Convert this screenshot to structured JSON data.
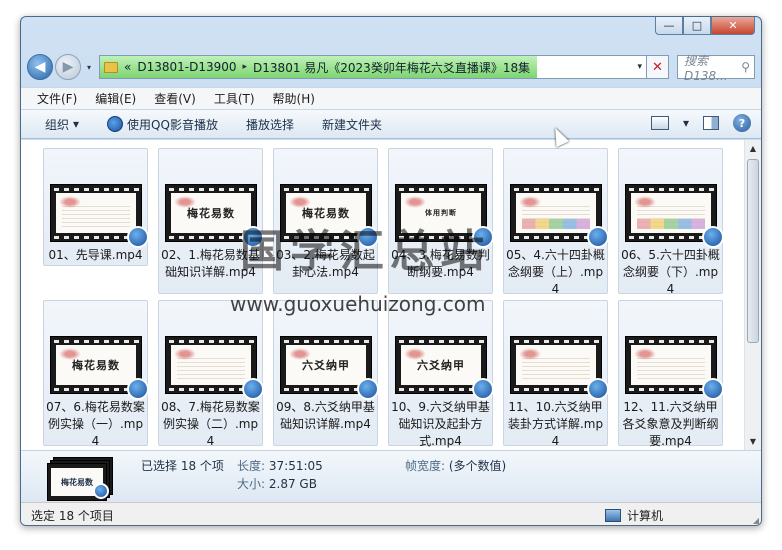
{
  "window": {
    "minimize_label": "—",
    "maximize_label": "□",
    "close_label": "✕"
  },
  "address_bar": {
    "back_label": "◀",
    "forward_label": "▶",
    "history_label": "▾",
    "chevron": "«",
    "crumbs": [
      "D13801-D13900",
      "D13801 易凡《2023癸卯年梅花六爻直播课》18集"
    ],
    "separator": "▸",
    "dropdown_label": "▾",
    "stop_label": "✕",
    "progress": 0.8
  },
  "search": {
    "placeholder": "搜索 D138...",
    "icon": "search-icon",
    "icon_glyph": "⚲"
  },
  "menu": [
    "文件(F)",
    "编辑(E)",
    "查看(V)",
    "工具(T)",
    "帮助(H)"
  ],
  "toolbar": {
    "organize": "组织",
    "organize_caret": "▾",
    "play_qq": "使用QQ影音播放",
    "play_selection": "播放选择",
    "new_folder": "新建文件夹",
    "view_caret": "▾",
    "help_label": "?"
  },
  "files": [
    {
      "name": "01、先导课.mp4",
      "thumb": "",
      "style": "deco"
    },
    {
      "name": "02、1.梅花易数基础知识详解.mp4",
      "thumb": "梅花易数",
      "style": "title"
    },
    {
      "name": "03、2.梅花易数起卦心法.mp4",
      "thumb": "梅花易数",
      "style": "title"
    },
    {
      "name": "04、3.梅花易数判断纲要.mp4",
      "thumb": "体用判断",
      "style": "small"
    },
    {
      "name": "05、4.六十四卦概念纲要（上）.mp4",
      "thumb": "",
      "style": "bars"
    },
    {
      "name": "06、5.六十四卦概念纲要（下）.mp4",
      "thumb": "",
      "style": "bars"
    },
    {
      "name": "07、6.梅花易数案例实操（一）.mp4",
      "thumb": "梅花易数",
      "style": "title"
    },
    {
      "name": "08、7.梅花易数案例实操（二）.mp4",
      "thumb": "",
      "style": "deco"
    },
    {
      "name": "09、8.六爻纳甲基础知识详解.mp4",
      "thumb": "六爻纳甲",
      "style": "title"
    },
    {
      "name": "10、9.六爻纳甲基础知识及起卦方式.mp4",
      "thumb": "六爻纳甲",
      "style": "title"
    },
    {
      "name": "11、10.六爻纳甲装卦方式详解.mp4",
      "thumb": "",
      "style": "deco"
    },
    {
      "name": "12、11.六爻纳甲各爻象意及判断纲要.mp4",
      "thumb": "",
      "style": "deco"
    }
  ],
  "scrollbar": {
    "up": "▲",
    "down": "▼"
  },
  "details": {
    "selected": "已选择 18 个项",
    "length_label": "长度:",
    "length_value": "37:51:05",
    "size_label": "大小:",
    "size_value": "2.87 GB",
    "framewidth_label": "帧宽度:",
    "framewidth_value": "(多个数值)",
    "stack_thumb": "梅花易数"
  },
  "status": {
    "left": "选定 18 个项目",
    "right": "计算机",
    "grip": "◢"
  },
  "watermark": {
    "text": "国学汇总站",
    "url": "www.guoxuehuizong.com"
  }
}
